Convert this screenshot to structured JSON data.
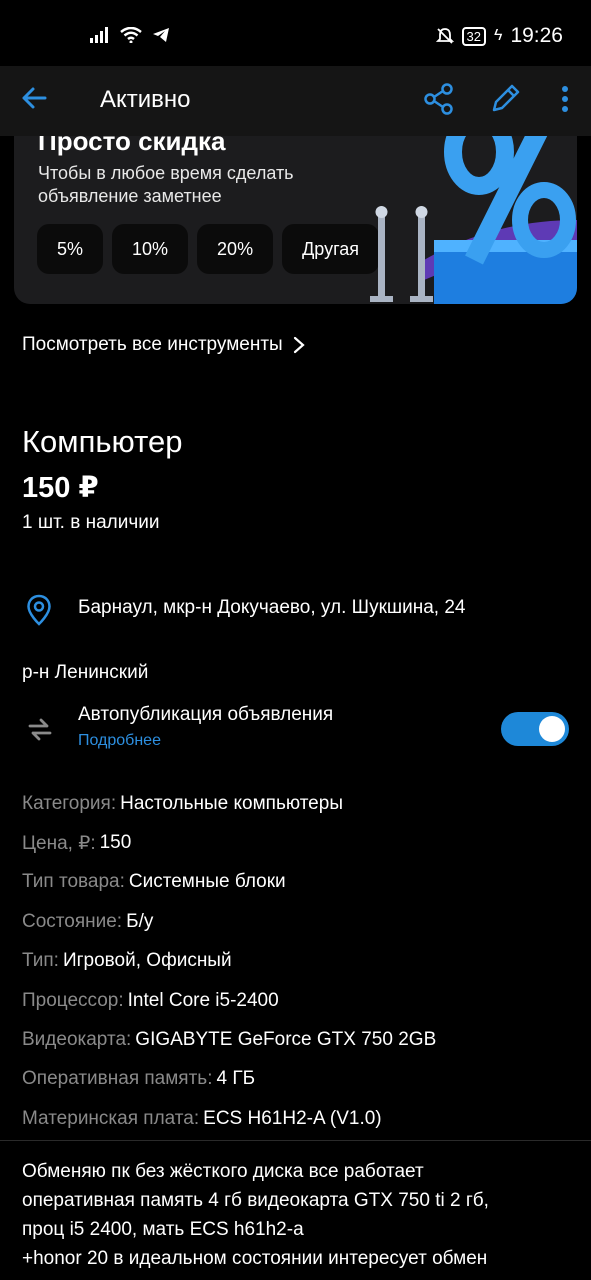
{
  "status_bar": {
    "battery": "32",
    "time": "19:26"
  },
  "app_bar": {
    "title": "Активно"
  },
  "promo": {
    "title": "Просто скидка",
    "subtitle": "Чтобы в любое время сделать объявление заметнее",
    "options": [
      "5%",
      "10%",
      "20%",
      "Другая"
    ]
  },
  "tools_link": "Посмотреть все инструменты",
  "listing": {
    "title": "Компьютер",
    "price": "150 ₽",
    "stock": "1 шт. в наличии",
    "address": "Барнаул, мкр-н Докучаево, ул. Шукшина, 24",
    "district": "р-н Ленинский"
  },
  "autopublish": {
    "label": "Автопубликация объявления",
    "link": "Подробнее",
    "enabled": true
  },
  "specs": [
    {
      "key": "Категория:",
      "value": "Настольные компьютеры"
    },
    {
      "key": "Цена, ₽:",
      "value": "150"
    },
    {
      "key": "Тип товара:",
      "value": "Системные блоки"
    },
    {
      "key": "Состояние:",
      "value": "Б/у"
    },
    {
      "key": "Тип:",
      "value": "Игровой, Офисный"
    },
    {
      "key": "Процессор:",
      "value": "Intel Core i5-2400"
    },
    {
      "key": "Видеокарта:",
      "value": "GIGABYTE GeForce GTX 750 2GB"
    },
    {
      "key": "Оперативная память:",
      "value": "4 ГБ"
    },
    {
      "key": "Материнская плата:",
      "value": "ECS H61H2-A (V1.0)"
    }
  ],
  "description": "Обменяю пк без жёсткого диска все работает\nоперативная память 4 гб видеокарта GTX 750 ti 2 гб,\nпроц i5 2400, мать ECS h61h2-a\n+honor 20 в идеальном состоянии интересует обмен",
  "colors": {
    "accent": "#2d8fe0",
    "background": "#000000",
    "card": "#1c1c1e",
    "muted_text": "#8a8a8a"
  }
}
